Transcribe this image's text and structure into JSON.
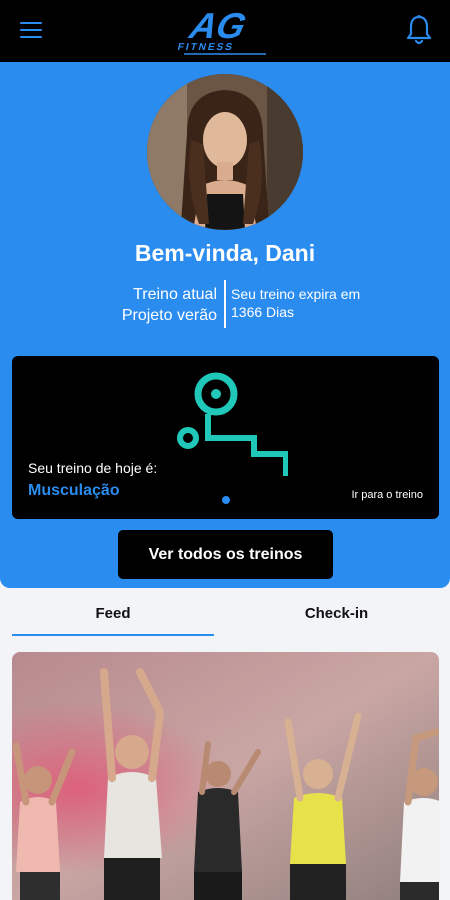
{
  "header": {
    "menu_icon": "hamburger-menu-icon",
    "logo_text": "AG",
    "logo_subtext": "FITNESS",
    "notification_icon": "bell-icon",
    "accent_color": "#2b8cf0"
  },
  "profile": {
    "greeting": "Bem-vinda, Dani",
    "plan_label": "Treino atual",
    "plan_name": "Projeto verão",
    "expiry_line1": "Seu treino expira em",
    "expiry_line2": "1366 Dias"
  },
  "today_card": {
    "icon": "bench-press-icon",
    "label": "Seu treino de hoje é:",
    "workout": "Musculação",
    "link": "Ir para o treino"
  },
  "all_workouts_button": "Ver todos os treinos",
  "tabs": [
    {
      "label": "Feed",
      "active": true
    },
    {
      "label": "Check-in",
      "active": false
    }
  ],
  "feed": {
    "image": "group-dance-class-photo"
  }
}
